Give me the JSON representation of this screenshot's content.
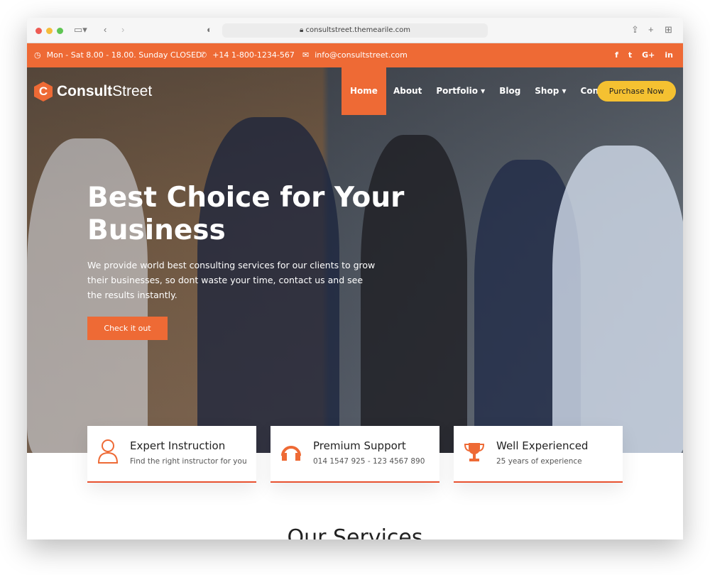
{
  "browser": {
    "url": "consultstreet.themearile.com"
  },
  "topbar": {
    "hours": "Mon - Sat 8.00 - 18.00. Sunday CLOSED",
    "phone": "+14 1-800-1234-567",
    "email": "info@consultstreet.com",
    "social": [
      "f",
      "t",
      "G+",
      "in"
    ]
  },
  "logo": {
    "mark": "C",
    "bold": "Consult",
    "light": "Street"
  },
  "nav": {
    "items": [
      "Home",
      "About",
      "Portfolio ▾",
      "Blog",
      "Shop ▾",
      "Contact"
    ],
    "cta": "Purchase Now"
  },
  "hero": {
    "title": "Best Choice for Your Business",
    "text": "We provide world best consulting services for our clients to grow their businesses, so dont waste your time, contact us and see the results instantly.",
    "button": "Check it out"
  },
  "features": [
    {
      "icon": "user-icon",
      "title": "Expert Instruction",
      "text": "Find the right instructor for you"
    },
    {
      "icon": "headphones-icon",
      "title": "Premium Support",
      "text": "014 1547 925 - 123 4567 890"
    },
    {
      "icon": "trophy-icon",
      "title": "Well Experienced",
      "text": "25 years of experience"
    }
  ],
  "services": {
    "title": "Our Services"
  },
  "colors": {
    "accent": "#ee6a35",
    "cta": "#f5c131"
  }
}
